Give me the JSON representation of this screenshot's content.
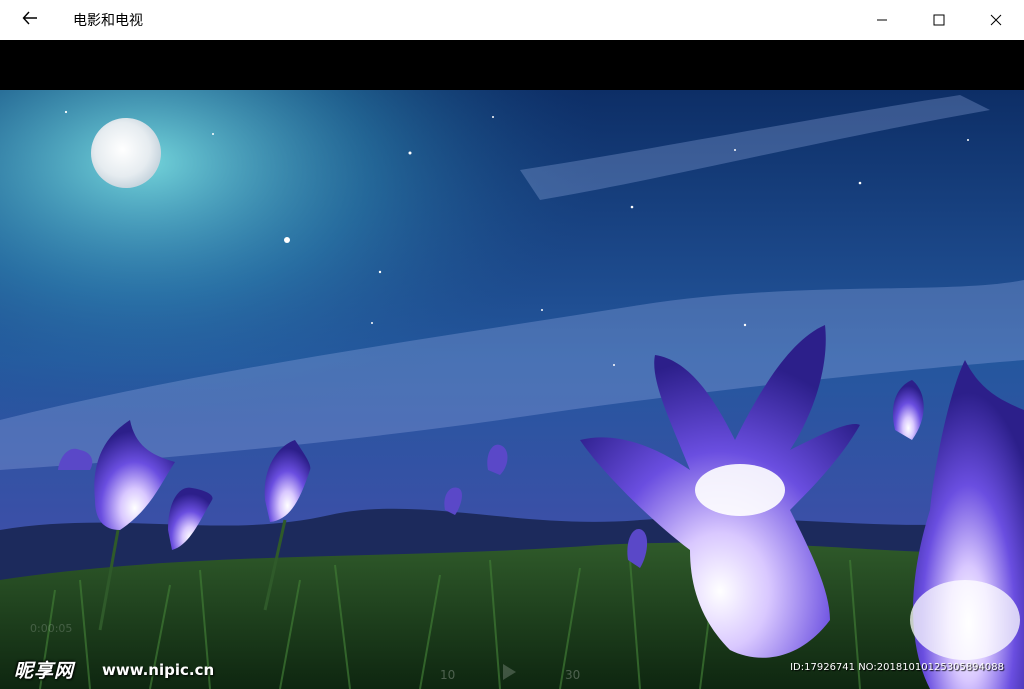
{
  "window": {
    "title": "电影和电视"
  },
  "icons": {
    "back": "back-arrow-icon",
    "minimize": "minimize-icon",
    "maximize": "maximize-icon",
    "close": "close-icon"
  },
  "watermark": {
    "logo_text": "昵享网",
    "url": "www.nipic.cn",
    "id_text": "ID:17926741 NO:20181010125305894088"
  },
  "player": {
    "time_text": "0:00:05",
    "skip_back_label": "10",
    "skip_forward_label": "30"
  },
  "colors": {
    "titlebar_bg": "#ffffff",
    "letterbox": "#000000",
    "sky_top": "#0b1f4a",
    "sky_glow": "#5ac8d8",
    "flower": "#6a4ee0"
  }
}
